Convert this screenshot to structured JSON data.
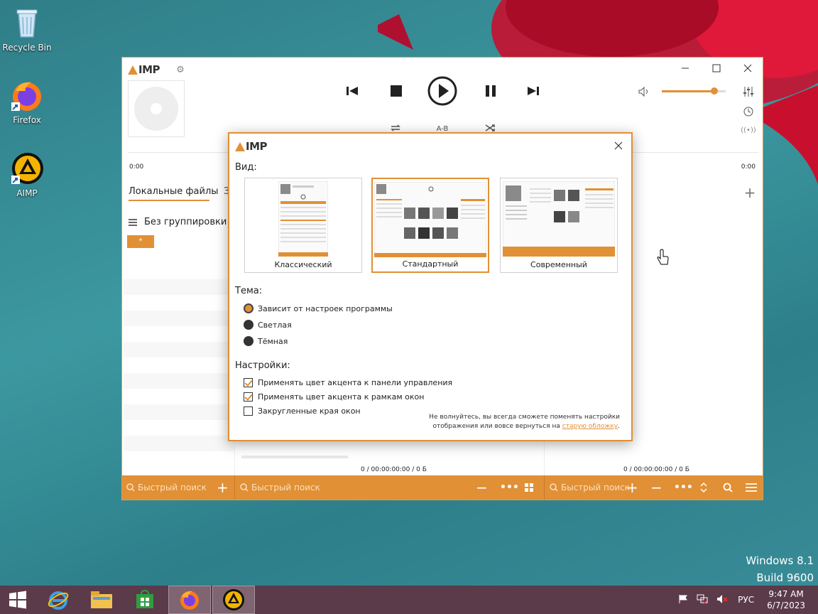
{
  "desktop": {
    "icons": [
      {
        "label": "Recycle Bin"
      },
      {
        "label": "Firefox"
      },
      {
        "label": "AIMP"
      }
    ],
    "windows_version": "Windows 8.1",
    "build": "Build 9600"
  },
  "taskbar": {
    "language": "РУС",
    "time": "9:47 AM",
    "date": "6/7/2023"
  },
  "player": {
    "logo_text": "IMP",
    "time_start": "0:00",
    "time_end": "0:00",
    "ab_label": "A-B",
    "volume_percent": 82,
    "tab_local_files": "Локальные файлы",
    "tab_second_partial": "З",
    "grouping_label": "Без группировки",
    "asterisk_label": "*",
    "status_left": "0 / 00:00:00:00 / 0 Б",
    "status_right": "0 / 00:00:00:00 / 0 Б",
    "search_placeholder": "Быстрый поиск",
    "accent_color": "#e19035"
  },
  "dialog": {
    "logo_text": "IMP",
    "view_label": "Вид:",
    "views": [
      {
        "label": "Классический",
        "selected": false
      },
      {
        "label": "Стандартный",
        "selected": true
      },
      {
        "label": "Современный",
        "selected": false
      }
    ],
    "theme_label": "Тема:",
    "themes": [
      {
        "label": "Зависит от настроек программы",
        "selected": true
      },
      {
        "label": "Светлая",
        "selected": false
      },
      {
        "label": "Тёмная",
        "selected": false
      }
    ],
    "settings_label": "Настройки:",
    "settings": [
      {
        "label": "Применять цвет акцента к панели управления",
        "checked": true
      },
      {
        "label": "Применять цвет акцента к рамкам окон",
        "checked": true
      },
      {
        "label": "Закругленные края окон",
        "checked": false
      }
    ],
    "note_line1": "Не волнуйтесь, вы всегда сможете поменять настройки",
    "note_line2": "отображения или вовсе вернуться на",
    "note_link": "старую обложку",
    "note_end": "."
  }
}
